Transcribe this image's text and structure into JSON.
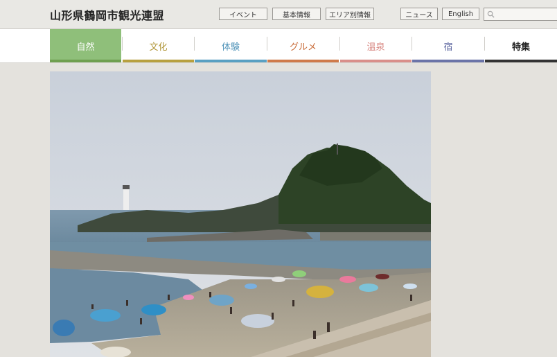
{
  "header": {
    "logo": "山形県鶴岡市観光連盟",
    "buttons": [
      "イベント",
      "基本情報",
      "エリア別情報",
      "ニュース",
      "English"
    ],
    "search_placeholder": ""
  },
  "nav": {
    "items": [
      {
        "label": "自然",
        "color": "#6f9f4f",
        "active": true
      },
      {
        "label": "文化",
        "color": "#b8a03e"
      },
      {
        "label": "体験",
        "color": "#5aa0c2"
      },
      {
        "label": "グルメ",
        "color": "#cf7a4a"
      },
      {
        "label": "温泉",
        "color": "#d98f8a"
      },
      {
        "label": "宿",
        "color": "#6b74a8"
      },
      {
        "label": "特集",
        "color": "#333333"
      }
    ]
  },
  "colors": {
    "background": "#e4e2dd",
    "header_bg": "#e9e8e4",
    "active_tab_bg": "#8fbf7a"
  }
}
